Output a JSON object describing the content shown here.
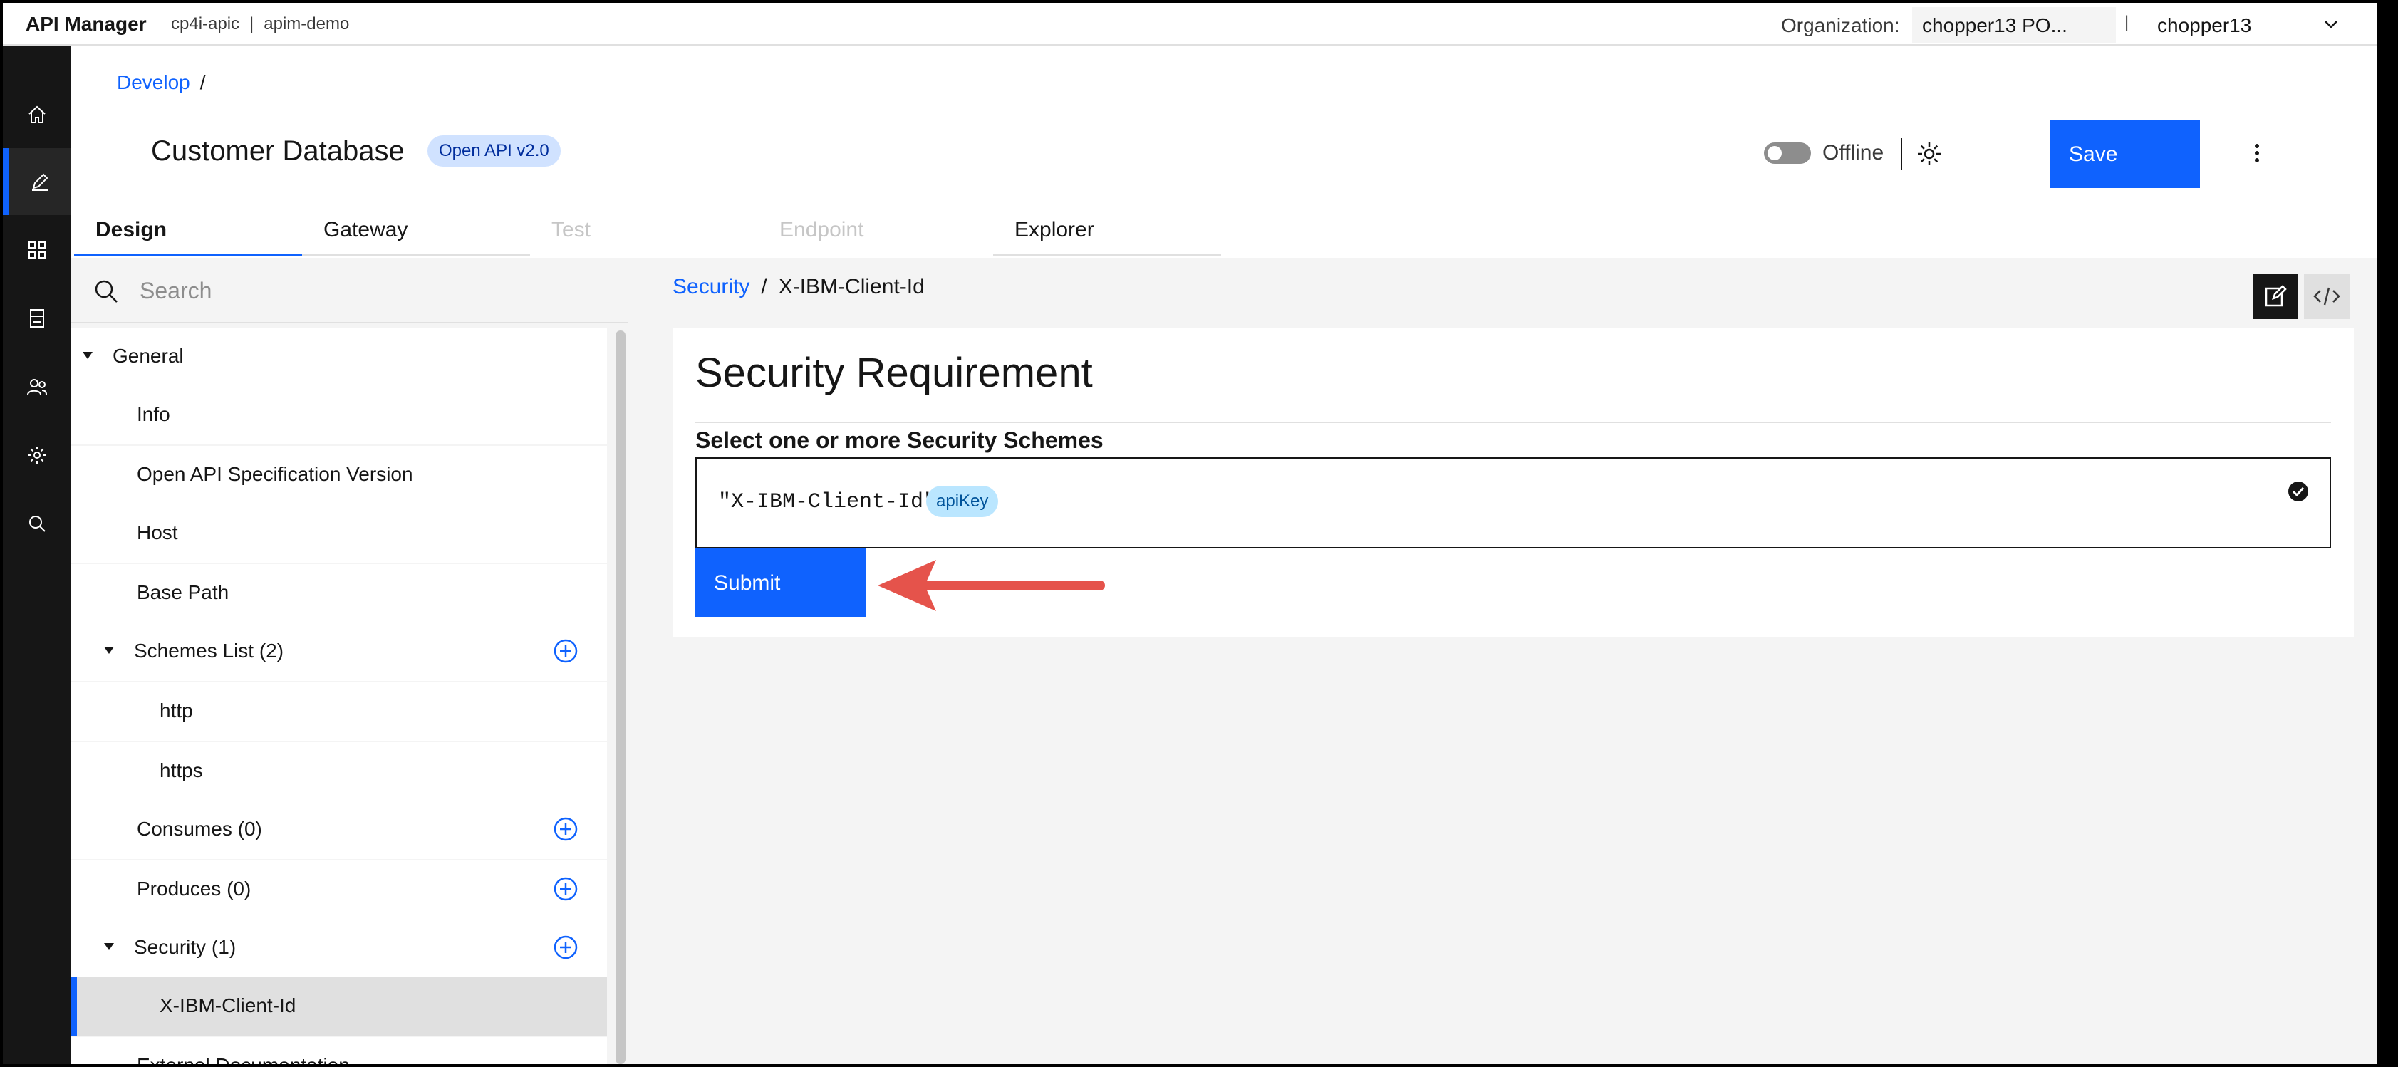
{
  "header": {
    "app_title": "API Manager",
    "context_catalog": "cp4i-apic",
    "context_separator": "|",
    "context_namespace": "apim-demo",
    "org_label": "Organization:",
    "org_value": "chopper13 PO...",
    "user_separator": "|",
    "user_name": "chopper13"
  },
  "rail": {
    "items": [
      "home-icon",
      "edit-icon",
      "apps-icon",
      "catalog-icon",
      "users-icon",
      "settings-icon",
      "search-icon"
    ]
  },
  "breadcrumb": {
    "develop": "Develop",
    "slash": "/"
  },
  "page": {
    "title": "Customer Database",
    "spec_tag": "Open API v2.0",
    "offline_label": "Offline",
    "save_label": "Save"
  },
  "tabs": [
    {
      "label": "Design",
      "state": "active"
    },
    {
      "label": "Gateway",
      "state": "normal"
    },
    {
      "label": "Test",
      "state": "disabled"
    },
    {
      "label": "Endpoint",
      "state": "disabled"
    },
    {
      "label": "Explorer",
      "state": "normal"
    }
  ],
  "nav": {
    "search_placeholder": "Search",
    "items": [
      {
        "label": "General"
      },
      {
        "label": "Info"
      },
      {
        "label": "Open API Specification Version"
      },
      {
        "label": "Host"
      },
      {
        "label": "Base Path"
      },
      {
        "label": "Schemes List (2)"
      },
      {
        "label": "http"
      },
      {
        "label": "https"
      },
      {
        "label": "Consumes (0)"
      },
      {
        "label": "Produces (0)"
      },
      {
        "label": "Security (1)"
      },
      {
        "label": "X-IBM-Client-Id"
      },
      {
        "label": "External Documentation"
      }
    ]
  },
  "content": {
    "crumb_link": "Security",
    "crumb_sep": "/",
    "crumb_current": "X-IBM-Client-Id",
    "card_title": "Security Requirement",
    "section_label": "Select one or more Security Schemes",
    "scheme_name": "\"X-IBM-Client-Id\"",
    "scheme_tag": "apiKey",
    "submit_label": "Submit"
  },
  "colors": {
    "accent": "#0f62fe",
    "rail_bg": "#161616",
    "annotation_arrow": "#e5534b"
  }
}
